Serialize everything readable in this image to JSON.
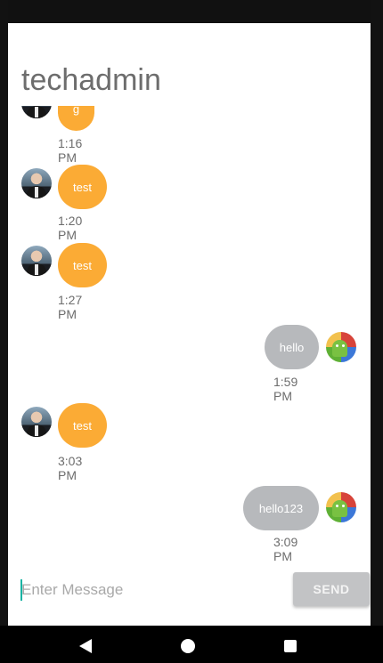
{
  "header": {
    "title": "techadmin"
  },
  "messages": [
    {
      "side": "them",
      "text": "g",
      "time": "1:16 PM"
    },
    {
      "side": "them",
      "text": "test",
      "time": "1:20 PM"
    },
    {
      "side": "them",
      "text": "test",
      "time": "1:27 PM"
    },
    {
      "side": "me",
      "text": "hello",
      "time": "1:59 PM"
    },
    {
      "side": "them",
      "text": "test",
      "time": "3:03 PM"
    },
    {
      "side": "me",
      "text": "hello123",
      "time": "3:09 PM"
    }
  ],
  "composer": {
    "placeholder": "Enter Message",
    "value": "",
    "send_label": "SEND"
  },
  "icons": {
    "contact_avatar": "person-avatar-icon",
    "own_avatar": "android-avatar-icon",
    "back": "back-triangle-icon",
    "home": "home-circle-icon",
    "recents": "recents-square-icon"
  },
  "colors": {
    "incoming_bubble": "#fbab35",
    "outgoing_bubble": "#b7b9bc",
    "cursor": "#17b3a3"
  }
}
